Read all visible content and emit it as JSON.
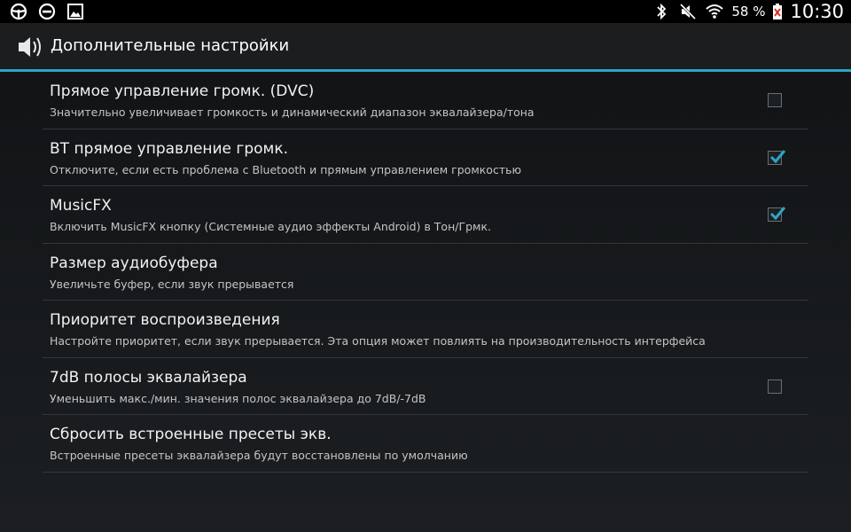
{
  "statusbar": {
    "icons_left": [
      "steering-wheel-icon",
      "do-not-disturb-icon",
      "image-icon"
    ],
    "icons_right": [
      "bluetooth-icon",
      "mute-icon",
      "wifi-icon",
      "battery-icon"
    ],
    "battery": "58 %",
    "time": "10:30"
  },
  "actionbar": {
    "title": "Дополнительные настройки",
    "icon": "speaker-icon"
  },
  "colors": {
    "accent": "#2ba5c9",
    "background": "#141618"
  },
  "settings": [
    {
      "title": "Прямое управление громк. (DVC)",
      "summary": "Значительно увеличивает громкость и динамический диапазон эквалайзера/тона",
      "has_checkbox": true,
      "checked": false
    },
    {
      "title": "BT прямое управление громк.",
      "summary": "Отключите, если есть проблема с Bluetooth и прямым управлением громкостью",
      "has_checkbox": true,
      "checked": true
    },
    {
      "title": "MusicFX",
      "summary": "Включить MusicFX кнопку (Системные аудио эффекты Android) в Тон/Грмк.",
      "has_checkbox": true,
      "checked": true
    },
    {
      "title": "Размер аудиобуфера",
      "summary": "Увеличьте буфер, если звук прерывается",
      "has_checkbox": false,
      "checked": false
    },
    {
      "title": "Приоритет воспроизведения",
      "summary": "Настройте приоритет, если звук прерывается. Эта опция может повлиять на производительность интерфейса",
      "has_checkbox": false,
      "checked": false
    },
    {
      "title": "7dB полосы эквалайзера",
      "summary": "Уменьшить макс./мин. значения полос эквалайзера до 7dB/-7dB",
      "has_checkbox": true,
      "checked": false
    },
    {
      "title": "Сбросить встроенные пресеты экв.",
      "summary": "Встроенные пресеты эквалайзера будут восстановлены по умолчанию",
      "has_checkbox": false,
      "checked": false
    }
  ]
}
